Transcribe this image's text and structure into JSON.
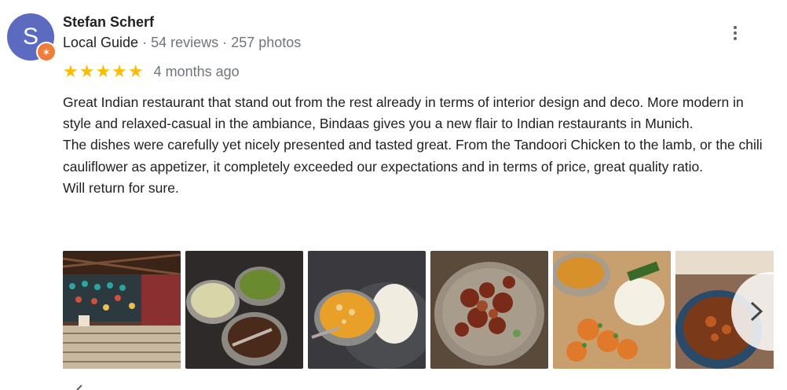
{
  "reviewer": {
    "avatar_letter": "S",
    "name": "Stefan Scherf",
    "local_guide": "Local Guide",
    "separator": "·",
    "reviews": "54 reviews",
    "photos": "257 photos"
  },
  "rating": {
    "stars": "★★★★★",
    "value": 5,
    "date": "4 months ago"
  },
  "review": {
    "para1": "Great Indian restaurant that stand out from the rest already in terms of interior design and deco. More modern in style and relaxed-casual in the ambiance, Bindaas gives you a new flair to Indian restaurants in Munich.",
    "para2": "The dishes were carefully yet nicely presented and tasted great. From the Tandoori Chicken to the lamb, or the chili cauliflower as appetizer, it completely exceeded our expectations and in terms of price, great quality ratio.",
    "para3": "Will return for sure."
  },
  "colors": {
    "avatar_bg": "#5c6bc0",
    "badge": "#f07c3a",
    "star": "#fbbc04",
    "secondary_text": "#70757a"
  },
  "icons": {
    "more": "more-vert-icon",
    "next": "chevron-right-icon",
    "badge": "local-guide-star-icon"
  }
}
